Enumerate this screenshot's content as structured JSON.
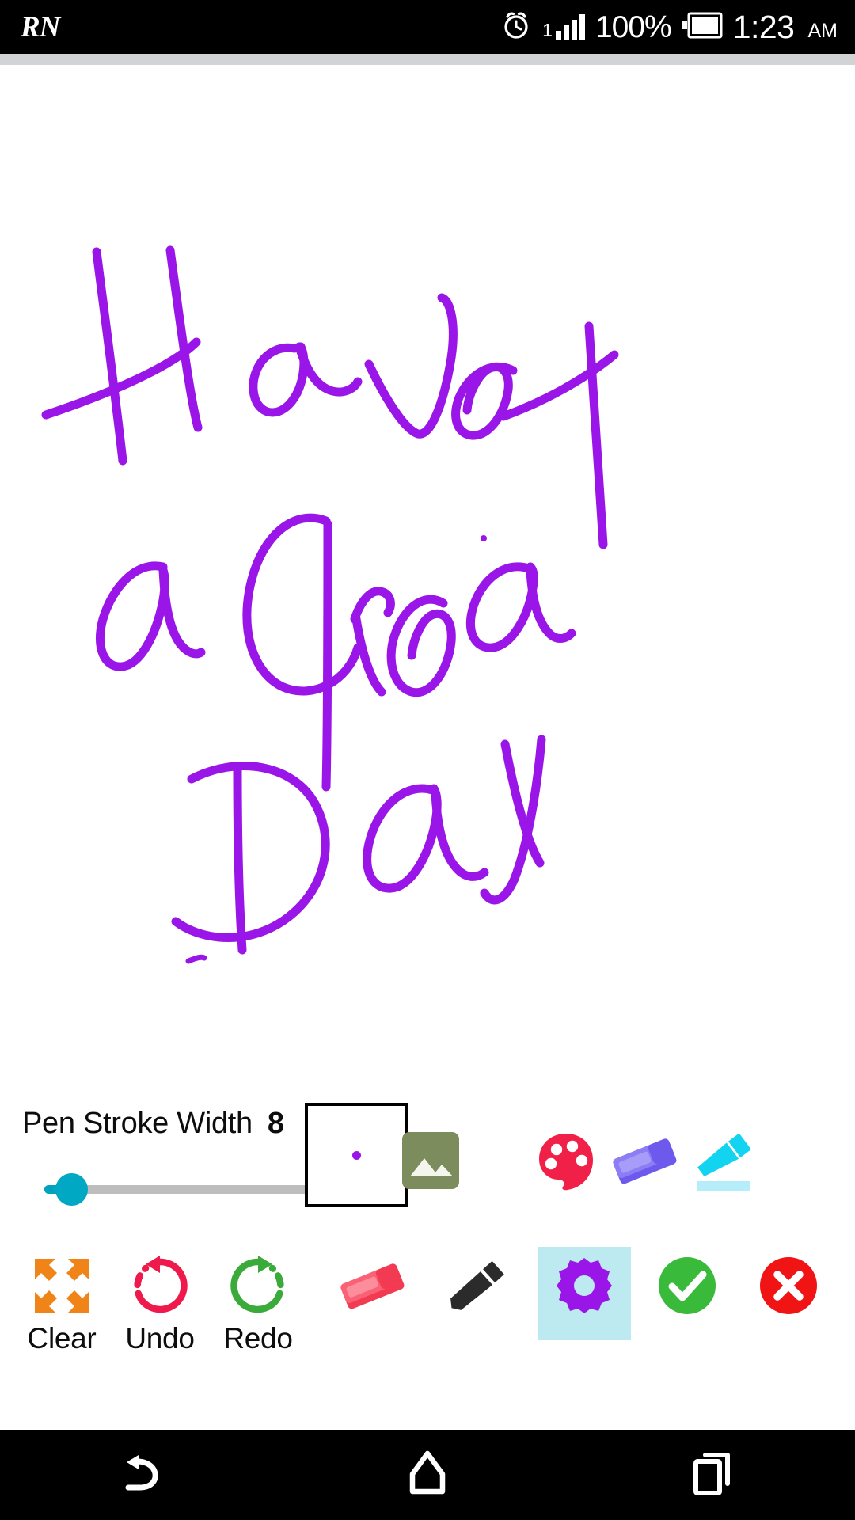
{
  "status_bar": {
    "brand": "RN",
    "alarm_icon": "alarm-clock-icon",
    "signal_prefix": "1",
    "signal_icon": "signal-bars-icon",
    "battery_percent": "100%",
    "battery_icon": "battery-full-icon",
    "time": "1:23",
    "ampm": "AM"
  },
  "canvas": {
    "name": "drawing-canvas",
    "handwriting_text": "Have a Great Day",
    "ink_color": "#9a16e8",
    "background": "#ffffff"
  },
  "settings": {
    "stroke_width_label": "Pen Stroke Width",
    "stroke_width_value": "8",
    "slider": {
      "name": "pen-stroke-width-slider",
      "min": "1",
      "max": "60",
      "value": "8",
      "thumb_color": "#00a8c4",
      "track_color": "#bdbdbd"
    },
    "preview": {
      "name": "stroke-preview",
      "dot_color": "#9a16e8",
      "border_color": "#000000"
    },
    "tools": [
      {
        "name": "image-icon",
        "label": "Image",
        "color": "#7d8c5c"
      },
      {
        "name": "color-palette-icon",
        "label": "Color",
        "color": "#f02048"
      },
      {
        "name": "eraser-purple-icon",
        "label": "Eraser",
        "color": "#7c6bf0"
      },
      {
        "name": "highlighter-icon",
        "label": "Highlighter",
        "color": "#12d4f0"
      }
    ]
  },
  "toolbar": {
    "clear_label": "Clear",
    "undo_label": "Undo",
    "redo_label": "Redo",
    "clear_icon": "expand-arrows-icon",
    "undo_icon": "undo-arrow-icon",
    "redo_icon": "redo-arrow-icon",
    "eraser_icon": "eraser-red-icon",
    "pencil_icon": "pencil-icon",
    "settings_icon": "gear-icon",
    "accept_icon": "check-circle-icon",
    "cancel_icon": "close-circle-icon",
    "clear_color": "#f08419",
    "undo_color": "#f0194b",
    "redo_color": "#3aab3a",
    "eraser_color": "#fa5a6e",
    "pencil_color": "#2b2b2b",
    "settings_color": "#9a16e8",
    "settings_selected_bg": "#bdeaf0",
    "accept_color": "#3aba3a",
    "cancel_color": "#f01414"
  },
  "nav_bar": {
    "back_icon": "back-arrow-icon",
    "home_icon": "home-icon",
    "recents_icon": "recent-apps-icon"
  }
}
